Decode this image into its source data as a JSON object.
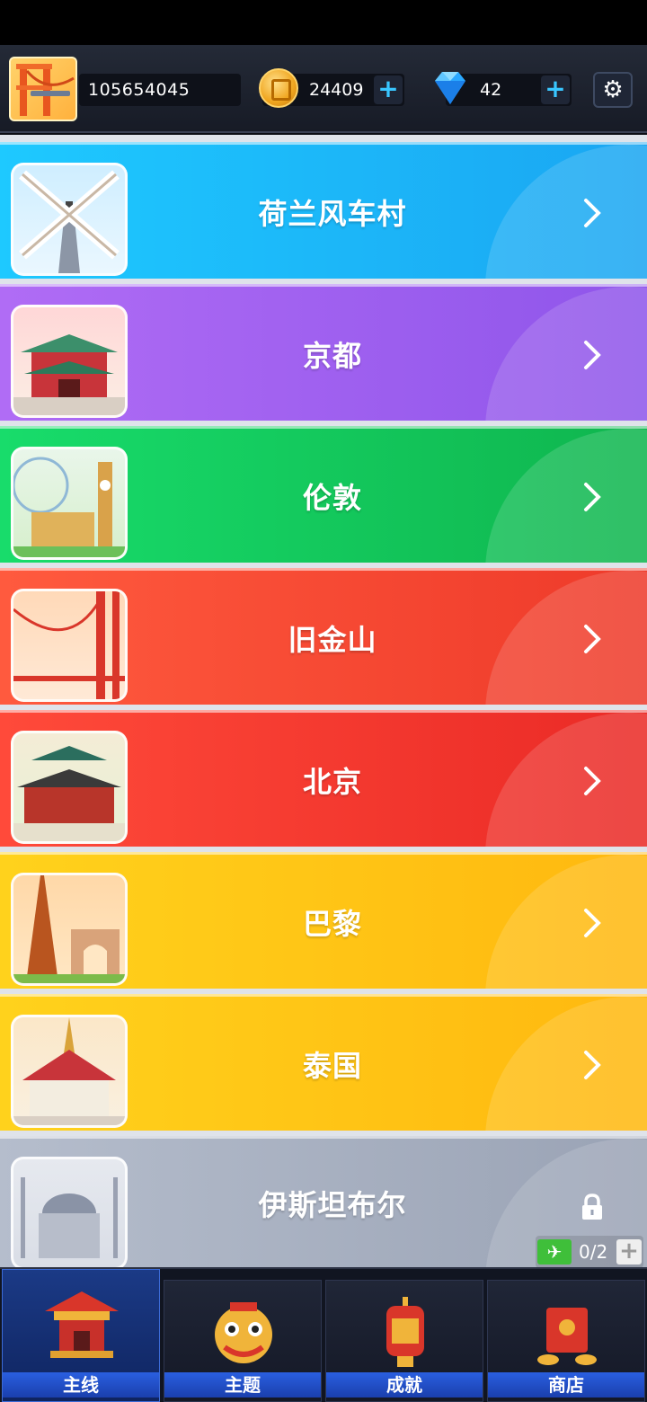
{
  "header": {
    "player_id": "105654045",
    "coins": "24409",
    "gems": "42",
    "coin_plus": "+",
    "gem_plus": "+"
  },
  "levels": [
    {
      "name": "荷兰风车村",
      "color_from": "#1ec9ff",
      "color_to": "#1aa6f2",
      "locked": false
    },
    {
      "name": "京都",
      "color_from": "#b06cf5",
      "color_to": "#8f55ea",
      "locked": false
    },
    {
      "name": "伦敦",
      "color_from": "#18dc6b",
      "color_to": "#0fb54e",
      "locked": false
    },
    {
      "name": "旧金山",
      "color_from": "#ff5a3e",
      "color_to": "#ee3a2a",
      "locked": false
    },
    {
      "name": "北京",
      "color_from": "#ff4a3a",
      "color_to": "#ea2a26",
      "locked": false
    },
    {
      "name": "巴黎",
      "color_from": "#ffd21c",
      "color_to": "#ffb80f",
      "locked": false
    },
    {
      "name": "泰国",
      "color_from": "#ffd21c",
      "color_to": "#ffb80f",
      "locked": false
    },
    {
      "name": "伊斯坦布尔",
      "color_from": "#b5bdcc",
      "color_to": "#9aa3b5",
      "locked": true,
      "progress": "0/2",
      "progress_plus": "+"
    }
  ],
  "tabs": [
    {
      "label": "主线",
      "active": true
    },
    {
      "label": "主题",
      "active": false
    },
    {
      "label": "成就",
      "active": false
    },
    {
      "label": "商店",
      "active": false
    }
  ]
}
